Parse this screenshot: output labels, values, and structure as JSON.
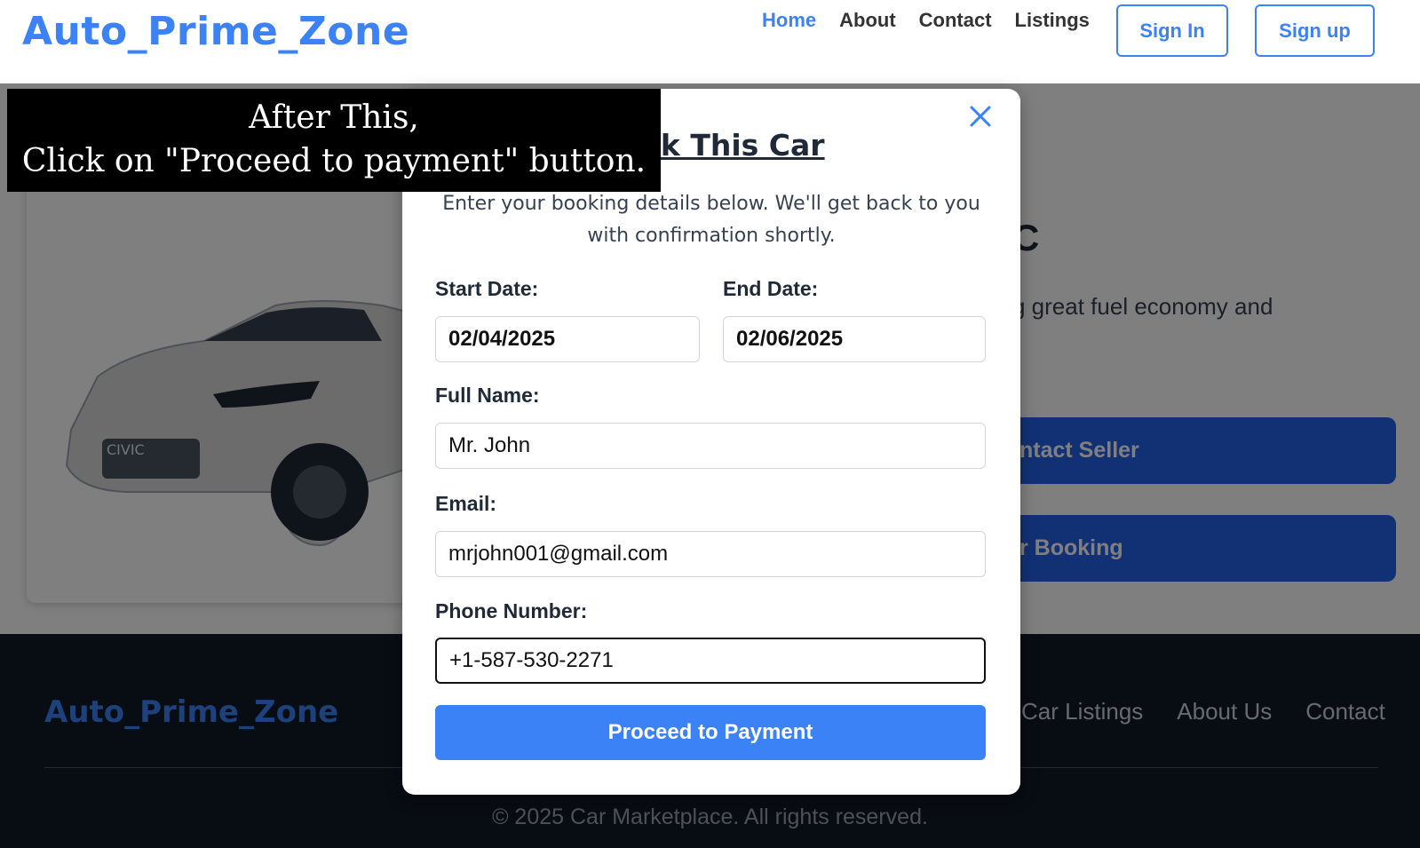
{
  "header": {
    "logo": "Auto_Prime_Zone",
    "nav": [
      "Home",
      "About",
      "Contact",
      "Listings"
    ],
    "sign_in": "Sign In",
    "sign_up": "Sign up"
  },
  "car": {
    "badge": "CIVIC",
    "title_visible": "C",
    "desc_visible": "g great fuel economy and",
    "contact_button": "ntact Seller",
    "booking_button": "r Booking"
  },
  "modal": {
    "title": "Book This Car",
    "subtitle_line1": "Enter your booking details below. We'll get back to you",
    "subtitle_line2": "with confirmation shortly.",
    "start_label": "Start Date:",
    "start_value": "02/04/2025",
    "end_label": "End Date:",
    "end_value": "02/06/2025",
    "name_label": "Full Name:",
    "name_value": "Mr. John",
    "email_label": "Email:",
    "email_value": "mrjohn001@gmail.com",
    "phone_label": "Phone Number:",
    "phone_value": "+1-587-530-2271",
    "submit": "Proceed to Payment"
  },
  "footer": {
    "logo": "Auto_Prime_Zone",
    "links": [
      "Car Listings",
      "About Us",
      "Contact"
    ],
    "copyright": "© 2025 Car Marketplace. All rights reserved."
  },
  "instruction": {
    "line1": "After This,",
    "line2": "Click on \"Proceed to payment\" button."
  },
  "colors": {
    "accent": "#3b82f6",
    "button_dark": "#2563eb",
    "footer_bg": "#111827"
  }
}
